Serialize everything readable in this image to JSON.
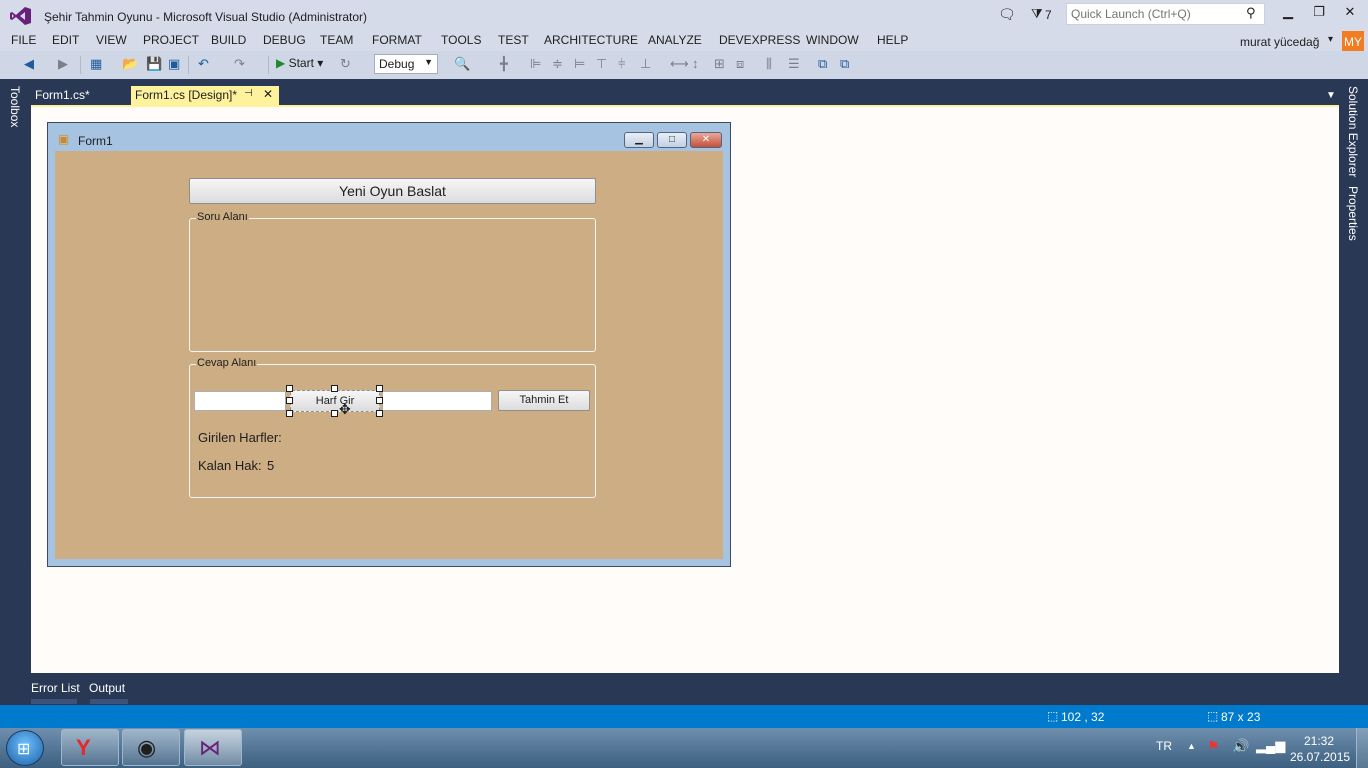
{
  "titlebar": {
    "title": "Şehir Tahmin Oyunu - Microsoft Visual Studio (Administrator)",
    "notification_count": "7",
    "quick_launch_placeholder": "Quick Launch (Ctrl+Q)"
  },
  "menu": {
    "items": [
      "FILE",
      "EDIT",
      "VIEW",
      "PROJECT",
      "BUILD",
      "DEBUG",
      "TEAM",
      "FORMAT",
      "TOOLS",
      "TEST",
      "ARCHITECTURE",
      "ANALYZE",
      "DEVEXPRESS",
      "WINDOW",
      "HELP"
    ],
    "user_name": "murat yücedağ",
    "avatar_initials": "MY"
  },
  "toolbar": {
    "start_label": "Start",
    "configuration": "Debug"
  },
  "side_panels": {
    "left": "Toolbox",
    "right_top": "Solution Explorer",
    "right_bottom": "Properties"
  },
  "tabs": {
    "code": "Form1.cs*",
    "design": "Form1.cs [Design]*"
  },
  "form": {
    "title": "Form1",
    "new_game_button": "Yeni Oyun Baslat",
    "question_group": "Soru Alanı",
    "answer_group": "Cevap Alanı",
    "letter_button": "Harf Gir",
    "guess_button": "Tahmin Et",
    "entered_letters_label": "Girilen Harfler:",
    "remaining_label": "Kalan Hak:",
    "remaining_value": "5"
  },
  "bottom_tabs": [
    "Error List",
    "Output"
  ],
  "statusbar": {
    "position": "102 , 32",
    "size": "87 x 23"
  },
  "taskbar": {
    "language": "TR",
    "time": "21:32",
    "date": "26.07.2015"
  },
  "colors": {
    "accent": "#007acc",
    "form_back": "#cdad83",
    "tab_active": "#fff29d"
  }
}
